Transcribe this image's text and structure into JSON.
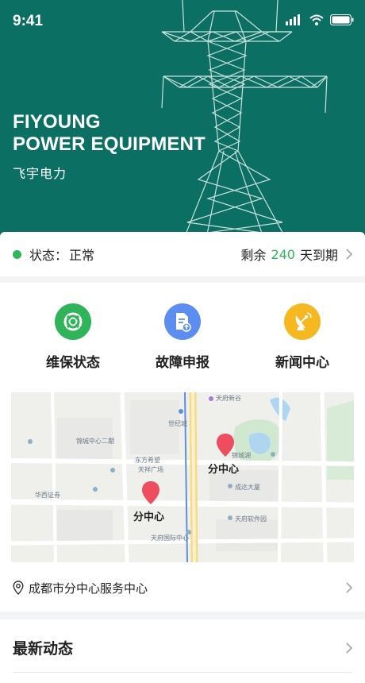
{
  "statusbar": {
    "time": "9:41"
  },
  "hero": {
    "brand_line1": "FIYOUNG",
    "brand_line2": "POWER EQUIPMENT",
    "brand_cn": "飞宇电力"
  },
  "status": {
    "label": "状态：",
    "value": "正常",
    "remain_prefix": "剩余",
    "remain_days": "240",
    "remain_suffix": "天到期",
    "dot_color": "#2fb45a"
  },
  "actions": [
    {
      "label": "维保状态",
      "icon": "lifebuoy-icon",
      "color": "#2fb45a"
    },
    {
      "label": "故障申报",
      "icon": "report-document-icon",
      "color": "#5b8ef0"
    },
    {
      "label": "新闻中心",
      "icon": "satellite-dish-icon",
      "color": "#f5b820"
    }
  ],
  "map": {
    "pins": [
      {
        "label": "分中心"
      },
      {
        "label": "分中心"
      }
    ],
    "places": {
      "p1": "天府新谷",
      "p2": "锦城中心二期",
      "p3": "东方希望",
      "p4": "天祥广场",
      "p5": "华西证券",
      "p6": "天府国际中心",
      "p7": "成达大厦",
      "p8": "天府软件园",
      "p9": "世纪城",
      "p10": "锦城湖"
    }
  },
  "address": {
    "text": "成都市分中心服务中心"
  },
  "news": {
    "title": "最新动态"
  }
}
